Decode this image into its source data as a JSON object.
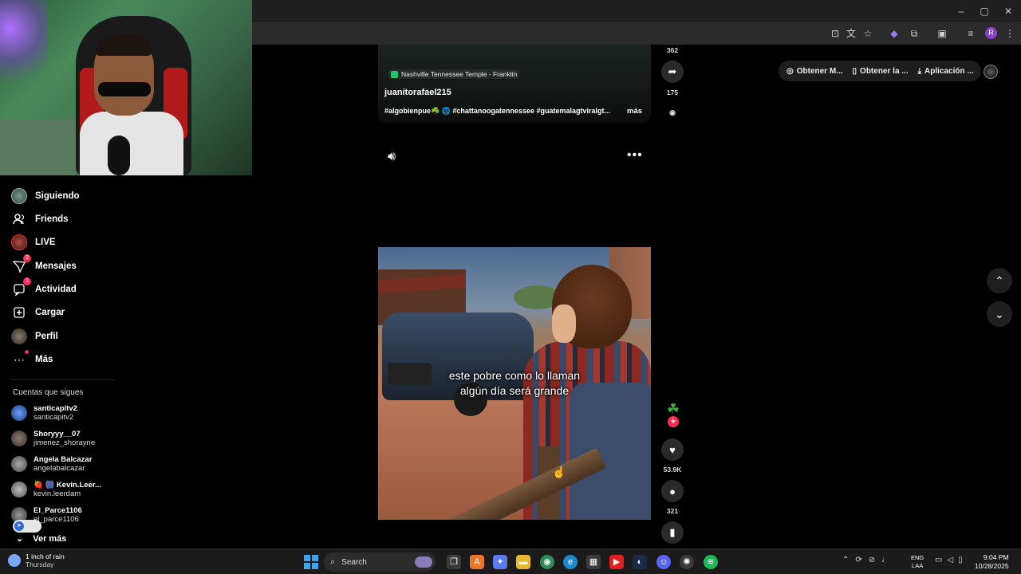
{
  "window": {
    "controls": [
      "–",
      "▢",
      "✕"
    ]
  },
  "sidebar": {
    "items": [
      {
        "label": "Siguiendo",
        "icon": "following-avatar"
      },
      {
        "label": "Friends",
        "icon": "friends-icon"
      },
      {
        "label": "LIVE",
        "icon": "live-avatar"
      },
      {
        "label": "Mensajes",
        "icon": "messages-icon",
        "badge": "2"
      },
      {
        "label": "Actividad",
        "icon": "activity-icon",
        "badge": "1"
      },
      {
        "label": "Cargar",
        "icon": "upload-icon"
      },
      {
        "label": "Perfil",
        "icon": "profile-avatar"
      },
      {
        "label": "Más",
        "icon": "more-icon"
      }
    ],
    "following_title": "Cuentas que sigues",
    "accounts": [
      {
        "name": "santicapitv2",
        "user": "santicapitv2"
      },
      {
        "name": "Shoryyy__07",
        "user": "jimenez_shorayne"
      },
      {
        "name": "Angela Balcazar",
        "user": "angelabalcazar"
      },
      {
        "name": "🍓 🎆 Kevin.Leer...",
        "user": "kevin.leerdam"
      },
      {
        "name": "El_Parce1106",
        "user": "el_parce1106"
      }
    ],
    "see_more": "Ver más"
  },
  "prev_video": {
    "location": "Nashville Tennessee Temple - Franklin",
    "author": "juanitorafael215",
    "tags": "#algobienpue☘️ 🌐 #chattanoogatennessee #guatemalagtviralgt...",
    "more": "más",
    "share_count": "175",
    "top_count": "362"
  },
  "main_video": {
    "caption_line1": "este pobre como lo llaman",
    "caption_line2": "algún día será grande",
    "likes": "53.9K",
    "comments": "321",
    "creator_icon": "☘",
    "follow_plus": "+"
  },
  "top_actions": [
    {
      "icon": "◎",
      "label": "Obtener M..."
    },
    {
      "icon": "▯",
      "label": "Obtener la ..."
    },
    {
      "icon": "⤓",
      "label": "Aplicación ..."
    }
  ],
  "taskbar": {
    "weather_title": "1 inch of rain",
    "weather_sub": "Thursday",
    "search_label": "Search",
    "lang_line1": "ENG",
    "lang_line2": "LAA",
    "time": "9:04 PM",
    "date": "10/28/2025"
  }
}
